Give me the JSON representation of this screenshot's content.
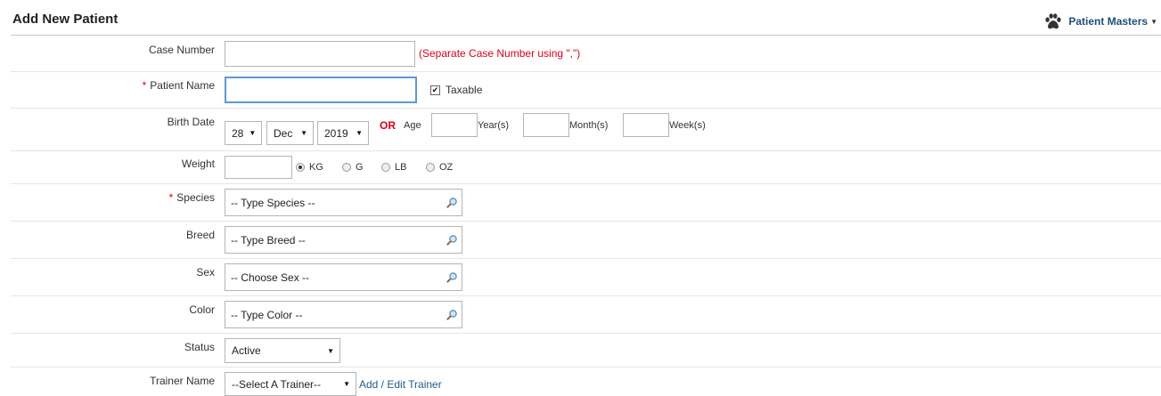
{
  "page": {
    "title": "Add New Patient",
    "masters_menu": "Patient Masters",
    "masters_icon": "paw-icon"
  },
  "form": {
    "case_number": {
      "label": "Case Number",
      "value": "",
      "hint": "(Separate Case Number using \",\")"
    },
    "patient_name": {
      "required_mark": "*",
      "label": "Patient Name",
      "value": "",
      "taxable_label": "Taxable",
      "taxable_checked": true
    },
    "birth_date": {
      "label": "Birth Date",
      "day": "28",
      "month": "Dec",
      "year": "2019",
      "or_label": "OR",
      "age_label": "Age",
      "years_label": "Year(s)",
      "months_label": "Month(s)",
      "weeks_label": "Week(s)",
      "years_value": "",
      "months_value": "",
      "weeks_value": ""
    },
    "weight": {
      "label": "Weight",
      "value": "",
      "units": [
        "KG",
        "G",
        "LB",
        "OZ"
      ],
      "selected_unit": "KG"
    },
    "species": {
      "required_mark": "*",
      "label": "Species",
      "placeholder": "-- Type Species --"
    },
    "breed": {
      "label": "Breed",
      "placeholder": "-- Type Breed --"
    },
    "sex": {
      "label": "Sex",
      "placeholder": "-- Choose Sex --"
    },
    "color": {
      "label": "Color",
      "placeholder": "-- Type Color --"
    },
    "status": {
      "label": "Status",
      "value": "Active"
    },
    "trainer": {
      "label": "Trainer Name",
      "value": "--Select A Trainer--",
      "link": "Add / Edit Trainer"
    }
  },
  "colors": {
    "required": "#d9001b",
    "link": "#1f5c8a",
    "focus": "#5b9bd5"
  }
}
